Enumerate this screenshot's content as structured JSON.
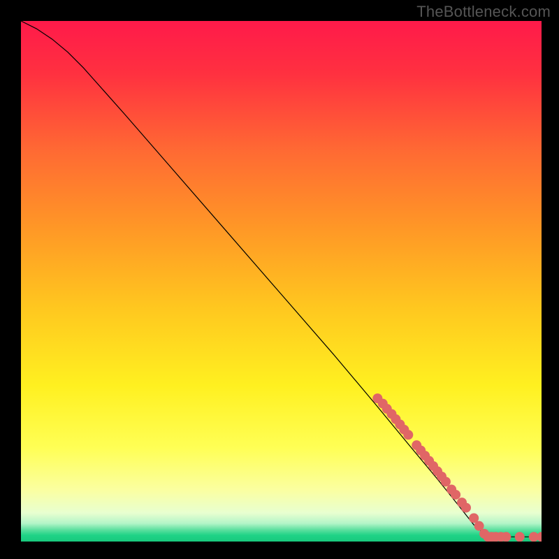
{
  "watermark": "TheBottleneck.com",
  "chart_data": {
    "type": "line",
    "title": "",
    "xlabel": "",
    "ylabel": "",
    "xlim": [
      0,
      100
    ],
    "ylim": [
      0,
      100
    ],
    "grid": false,
    "line_series": {
      "name": "curve",
      "color": "#000000",
      "points": [
        {
          "x": 0.0,
          "y": 100.0
        },
        {
          "x": 3.0,
          "y": 98.5
        },
        {
          "x": 6.0,
          "y": 96.5
        },
        {
          "x": 9.0,
          "y": 94.0
        },
        {
          "x": 12.0,
          "y": 91.0
        },
        {
          "x": 16.0,
          "y": 86.5
        },
        {
          "x": 20.0,
          "y": 82.0
        },
        {
          "x": 30.0,
          "y": 70.5
        },
        {
          "x": 40.0,
          "y": 59.0
        },
        {
          "x": 50.0,
          "y": 47.5
        },
        {
          "x": 60.0,
          "y": 36.0
        },
        {
          "x": 68.0,
          "y": 26.5
        },
        {
          "x": 75.0,
          "y": 18.0
        },
        {
          "x": 80.0,
          "y": 12.0
        },
        {
          "x": 84.0,
          "y": 7.0
        },
        {
          "x": 87.0,
          "y": 3.2
        },
        {
          "x": 89.0,
          "y": 1.5
        },
        {
          "x": 90.0,
          "y": 1.0
        },
        {
          "x": 92.0,
          "y": 0.9
        },
        {
          "x": 95.0,
          "y": 0.9
        },
        {
          "x": 100.0,
          "y": 0.9
        }
      ]
    },
    "scatter_series": {
      "name": "dots",
      "color": "#e06666",
      "radius": 7,
      "points": [
        {
          "x": 68.5,
          "y": 27.5
        },
        {
          "x": 69.5,
          "y": 26.5
        },
        {
          "x": 70.3,
          "y": 25.5
        },
        {
          "x": 71.2,
          "y": 24.5
        },
        {
          "x": 72.0,
          "y": 23.5
        },
        {
          "x": 72.8,
          "y": 22.5
        },
        {
          "x": 73.6,
          "y": 21.5
        },
        {
          "x": 74.4,
          "y": 20.5
        },
        {
          "x": 76.0,
          "y": 18.5
        },
        {
          "x": 76.8,
          "y": 17.5
        },
        {
          "x": 77.6,
          "y": 16.5
        },
        {
          "x": 78.4,
          "y": 15.5
        },
        {
          "x": 79.2,
          "y": 14.5
        },
        {
          "x": 80.0,
          "y": 13.5
        },
        {
          "x": 80.8,
          "y": 12.5
        },
        {
          "x": 81.6,
          "y": 11.5
        },
        {
          "x": 82.7,
          "y": 10.0
        },
        {
          "x": 83.5,
          "y": 9.0
        },
        {
          "x": 84.7,
          "y": 7.5
        },
        {
          "x": 85.5,
          "y": 6.5
        },
        {
          "x": 87.0,
          "y": 4.5
        },
        {
          "x": 88.0,
          "y": 3.0
        },
        {
          "x": 89.0,
          "y": 1.5
        },
        {
          "x": 89.7,
          "y": 0.9
        },
        {
          "x": 90.4,
          "y": 0.9
        },
        {
          "x": 91.2,
          "y": 0.9
        },
        {
          "x": 92.2,
          "y": 0.9
        },
        {
          "x": 93.2,
          "y": 0.9
        },
        {
          "x": 95.8,
          "y": 0.9
        },
        {
          "x": 98.5,
          "y": 0.9
        },
        {
          "x": 100.0,
          "y": 0.9
        }
      ]
    },
    "background_gradient": {
      "stops": [
        {
          "offset": 0.0,
          "color": "#ff1a4a"
        },
        {
          "offset": 0.1,
          "color": "#ff3040"
        },
        {
          "offset": 0.25,
          "color": "#ff6a33"
        },
        {
          "offset": 0.4,
          "color": "#ff9826"
        },
        {
          "offset": 0.55,
          "color": "#ffc71f"
        },
        {
          "offset": 0.7,
          "color": "#fff020"
        },
        {
          "offset": 0.82,
          "color": "#ffff55"
        },
        {
          "offset": 0.9,
          "color": "#fbffa0"
        },
        {
          "offset": 0.945,
          "color": "#e8ffd0"
        },
        {
          "offset": 0.965,
          "color": "#b4f5c8"
        },
        {
          "offset": 0.978,
          "color": "#5adf9e"
        },
        {
          "offset": 0.988,
          "color": "#1fd386"
        },
        {
          "offset": 1.0,
          "color": "#19c97e"
        }
      ]
    }
  }
}
